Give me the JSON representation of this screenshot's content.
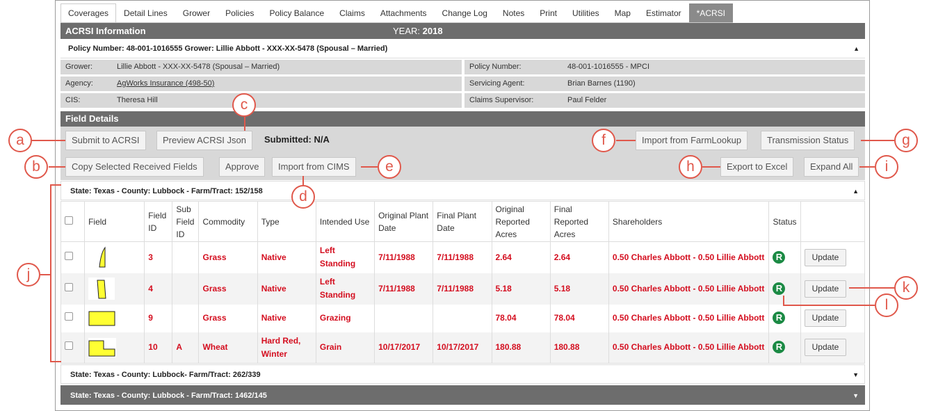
{
  "tabs": [
    "Coverages",
    "Detail Lines",
    "Grower",
    "Policies",
    "Policy Balance",
    "Claims",
    "Attachments",
    "Change Log",
    "Notes",
    "Print",
    "Utilities",
    "Map",
    "Estimator",
    "*ACRSI"
  ],
  "header": {
    "title": "ACRSI Information",
    "year_label": "YEAR:",
    "year_value": "2018"
  },
  "policy_summary": "Policy Number: 48-001-1016555 Grower: Lillie Abbott - XXX-XX-5478 (Spousal – Married)",
  "info": {
    "grower_label": "Grower:",
    "grower_value": "Lillie Abbott - XXX-XX-5478 (Spousal – Married)",
    "agency_label": "Agency:",
    "agency_value": "AgWorks Insurance (498-50)",
    "cis_label": "CIS:",
    "cis_value": "Theresa Hill",
    "policy_label": "Policy Number:",
    "policy_value": "48-001-1016555 - MPCI",
    "agent_label": "Servicing Agent:",
    "agent_value": "Brian Barnes (1190)",
    "supervisor_label": "Claims Supervisor:",
    "supervisor_value": "Paul Felder"
  },
  "field_details": {
    "title": "Field Details",
    "submit": "Submit to ACRSI",
    "preview": "Preview ACRSI Json",
    "submitted": "Submitted: N/A",
    "import_farm": "Import from FarmLookup",
    "transmission": "Transmission Status",
    "copy": "Copy Selected Received Fields",
    "approve": "Approve",
    "import_cims": "Import from CIMS",
    "export": "Export to Excel",
    "expand": "Expand All"
  },
  "farms": [
    "State: Texas - County: Lubbock - Farm/Tract: 152/158",
    "State: Texas - County: Lubbock- Farm/Tract: 262/339",
    "State: Texas - County: Lubbock - Farm/Tract: 1462/145"
  ],
  "columns": {
    "field": "Field",
    "field_id": "Field ID",
    "sub_field_id": "Sub Field ID",
    "commodity": "Commodity",
    "type": "Type",
    "intended_use": "Intended Use",
    "original_plant_date": "Original Plant Date",
    "final_plant_date": "Final Plant Date",
    "original_acres": "Original Reported Acres",
    "final_acres": "Final Reported Acres",
    "shareholders": "Shareholders",
    "status": "Status"
  },
  "rows": [
    {
      "field_id": "3",
      "sub_field_id": "",
      "commodity": "Grass",
      "type": "Native",
      "intended_use": "Left Standing",
      "original_plant_date": "7/11/1988",
      "final_plant_date": "7/11/1988",
      "original_acres": "2.64",
      "final_acres": "2.64",
      "shareholders": "0.50 Charles Abbott - 0.50 Lillie Abbott",
      "status": "R",
      "action": "Update"
    },
    {
      "field_id": "4",
      "sub_field_id": "",
      "commodity": "Grass",
      "type": "Native",
      "intended_use": "Left Standing",
      "original_plant_date": "7/11/1988",
      "final_plant_date": "7/11/1988",
      "original_acres": "5.18",
      "final_acres": "5.18",
      "shareholders": "0.50 Charles Abbott - 0.50 Lillie Abbott",
      "status": "R",
      "action": "Update"
    },
    {
      "field_id": "9",
      "sub_field_id": "",
      "commodity": "Grass",
      "type": "Native",
      "intended_use": "Grazing",
      "original_plant_date": "",
      "final_plant_date": "",
      "original_acres": "78.04",
      "final_acres": "78.04",
      "shareholders": "0.50 Charles Abbott - 0.50 Lillie Abbott",
      "status": "R",
      "action": "Update"
    },
    {
      "field_id": "10",
      "sub_field_id": "A",
      "commodity": "Wheat",
      "type": "Hard Red, Winter",
      "intended_use": "Grain",
      "original_plant_date": "10/17/2017",
      "final_plant_date": "10/17/2017",
      "original_acres": "180.88",
      "final_acres": "180.88",
      "shareholders": "0.50 Charles Abbott - 0.50 Lillie Abbott",
      "status": "R",
      "action": "Update"
    }
  ],
  "callouts": [
    "a",
    "b",
    "c",
    "d",
    "e",
    "f",
    "g",
    "h",
    "i",
    "j",
    "k",
    "l"
  ],
  "colors": {
    "accent_red": "#d40e1f",
    "callout": "#e0584b",
    "header_gray": "#6d6d6d",
    "status_green": "#1b8a44",
    "field_yellow": "#ffff33"
  }
}
